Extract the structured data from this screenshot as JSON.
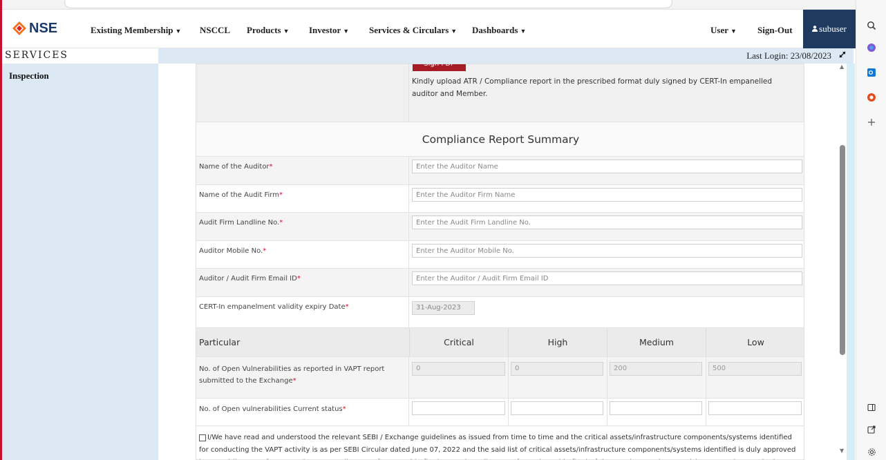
{
  "navbar": {
    "logo_text": "NSE",
    "items": [
      {
        "label": "Existing Membership",
        "caret": "▼"
      },
      {
        "label": "NSCCL",
        "caret": ""
      },
      {
        "label": "Products",
        "caret": "▼"
      },
      {
        "label": "Investor",
        "caret": "▼"
      },
      {
        "label": "Services & Circulars",
        "caret": "▼"
      },
      {
        "label": "Dashboards",
        "caret": "▼"
      }
    ],
    "user_label": "User",
    "user_caret": "▼",
    "signout_label": "Sign-Out",
    "username": "subuser"
  },
  "services_label": "SERVICES",
  "last_login": "Last Login: 23/08/2023",
  "sidebar": {
    "items": [
      {
        "label": "Inspection"
      }
    ]
  },
  "form": {
    "sign_button_label": "Sign PDF",
    "upload_note": "Kindly upload ATR / Compliance report in the prescribed format duly signed by CERT-In empanelled auditor and Member.",
    "summary_title": "Compliance Report Summary",
    "fields": [
      {
        "label": "Name of the Auditor",
        "placeholder": "Enter the Auditor Name"
      },
      {
        "label": "Name of the Audit Firm",
        "placeholder": "Enter the Auditor Firm Name"
      },
      {
        "label": "Audit Firm Landline No.",
        "placeholder": "Enter the Audit Firm Landline No."
      },
      {
        "label": "Auditor Mobile No.",
        "placeholder": "Enter the Auditor Mobile No."
      },
      {
        "label": "Auditor / Audit Firm Email ID",
        "placeholder": "Enter the Auditor / Audit Firm Email ID"
      }
    ],
    "expiry_label": "CERT-In empanelment validity expiry Date",
    "expiry_value": "31-Aug-2023",
    "required_mark": "*",
    "grid_headers": {
      "particular": "Particular",
      "critical": "Critical",
      "high": "High",
      "medium": "Medium",
      "low": "Low"
    },
    "reported_label": "No. of Open Vulnerabilities as reported in VAPT report submitted to the Exchange",
    "reported_values": {
      "critical": "0",
      "high": "0",
      "medium": "200",
      "low": "500"
    },
    "current_label": "No. of Open vulnerabilities Current status",
    "declaration": "I/We have read and understood the relevant SEBI / Exchange guidelines as issued from time to time and the critical assets/infrastructure components/systems identified for conducting the VAPT activity is as per SEBI Circular dated June 07, 2022 and the said list of critical assets/infrastructure components/systems identified is duly approved by Board (in case of Company) / Partners (in case of Partnership firm) / Proprietor (in case of Proprietorship firm) of the Member. Further we wish to state the attached Compliance report"
  },
  "colors": {
    "accent_red": "#a51c24",
    "nav_dark": "#1e3a5f",
    "sidebar_blue": "#dce8f3"
  },
  "icons": {
    "nse_logo": "nse-logo-icon",
    "user": "user-icon",
    "expand": "expand-icon",
    "edge_search": "search-icon",
    "edge_copilot": "copilot-icon",
    "edge_outlook": "outlook-icon",
    "edge_office": "office-icon",
    "edge_add": "add-icon",
    "edge_split": "split-screen-icon",
    "edge_external": "external-link-icon",
    "edge_settings": "gear-icon"
  }
}
